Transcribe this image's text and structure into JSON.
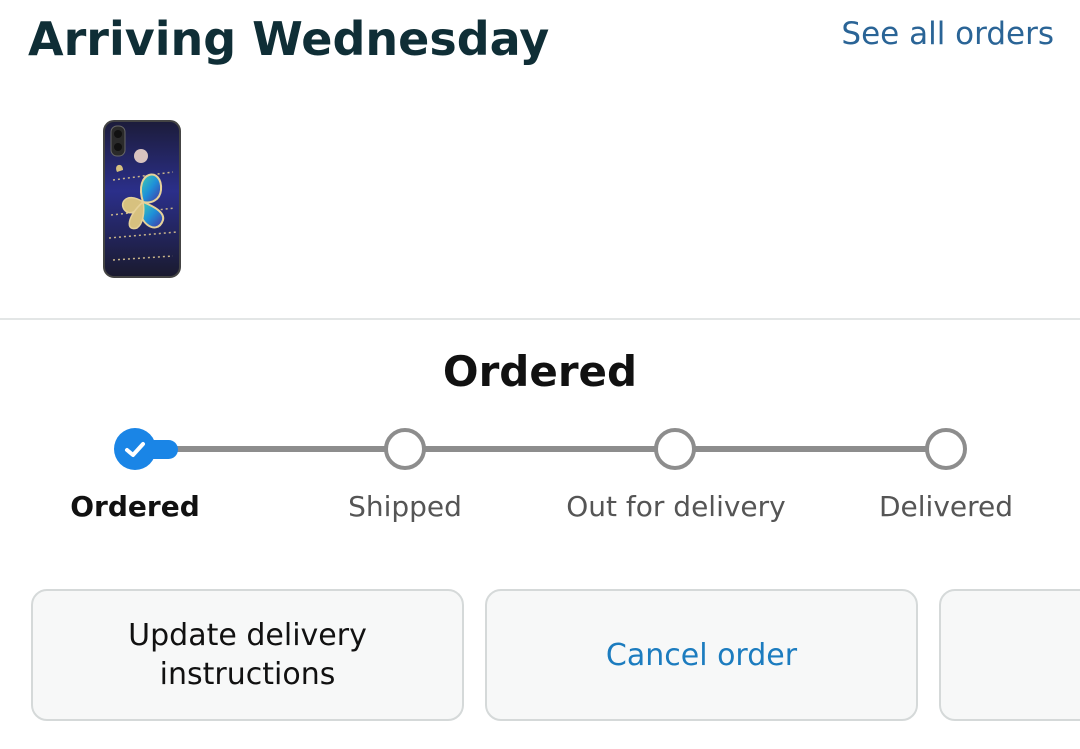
{
  "header": {
    "title": "Arriving Wednesday",
    "see_all_link": "See all orders"
  },
  "product": {
    "image_icon": "phone-case-butterfly-image"
  },
  "status": {
    "title": "Ordered",
    "current_step": 0,
    "steps": [
      {
        "label": "Ordered",
        "state": "complete"
      },
      {
        "label": "Shipped",
        "state": "pending"
      },
      {
        "label": "Out for delivery",
        "state": "pending"
      },
      {
        "label": "Delivered",
        "state": "pending"
      }
    ]
  },
  "actions": {
    "update_delivery_line1": "Update delivery",
    "update_delivery_line2": "instructions",
    "cancel_order": "Cancel order"
  },
  "colors": {
    "accent": "#1a85e6",
    "link": "#2a6496",
    "title": "#0f2e36",
    "track": "#8d8d8d"
  }
}
